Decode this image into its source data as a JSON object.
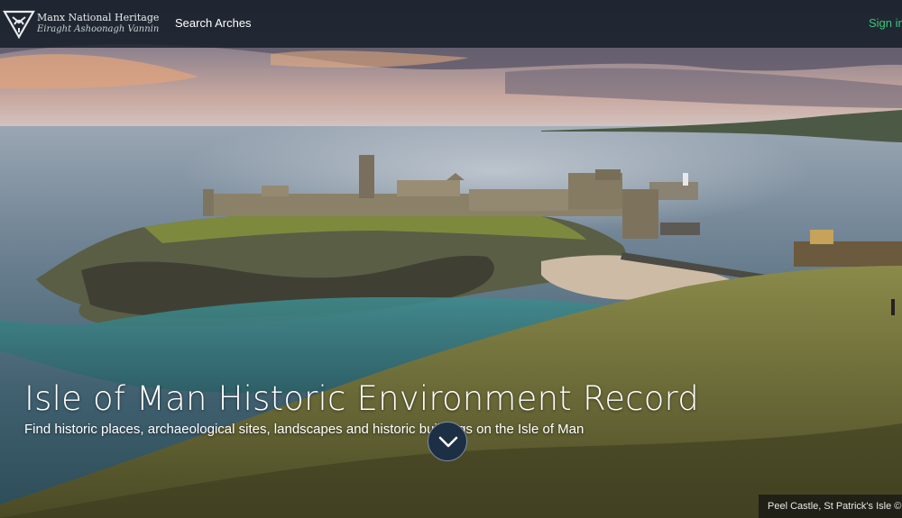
{
  "header": {
    "brand_name": "Manx National Heritage",
    "brand_subtitle": "Eiraght Ashoonagh Vannin",
    "nav_search": "Search Arches",
    "sign_in": "Sign in",
    "sign_in_color": "#3bc47a"
  },
  "hero": {
    "title": "Isle of Man Historic Environment Record",
    "subtitle": "Find historic places, archaeological sites, landscapes and historic buildings on the Isle of Man",
    "scroll_icon": "chevron-down-icon",
    "caption": "Peel Castle, St Patrick's Isle ©"
  }
}
